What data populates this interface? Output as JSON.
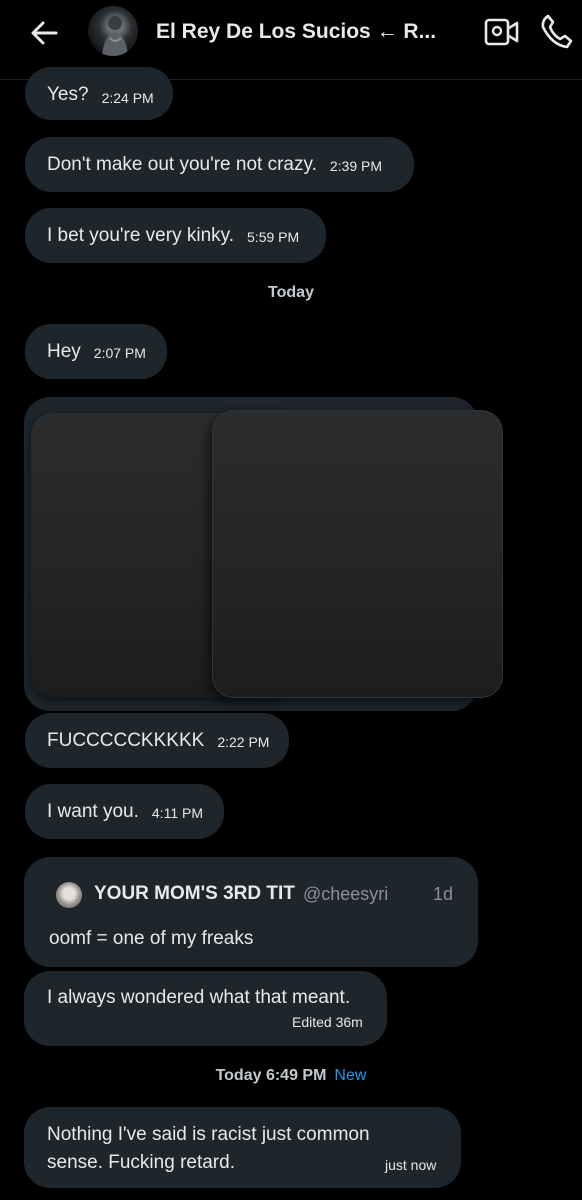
{
  "header": {
    "title": "El Rey De Los Sucios ← R...",
    "back_icon": "arrow-left-icon",
    "video_icon": "video-call-icon",
    "phone_icon": "phone-icon"
  },
  "messages": [
    {
      "text": "Yes?",
      "time": "2:24 PM"
    },
    {
      "text": "Don't make out you're not crazy.",
      "time": "2:39 PM"
    },
    {
      "text": "I bet you're very kinky.",
      "time": "5:59 PM"
    },
    {
      "text": "Hey",
      "time": "2:07 PM"
    },
    {
      "text": "FUCCCCCKKKKK",
      "time": "2:22 PM"
    },
    {
      "text": "I want you.",
      "time": "4:11 PM"
    }
  ],
  "dividers": {
    "today": "Today",
    "today_time": "Today 6:49 PM",
    "new_label": "New"
  },
  "quoted_post": {
    "name": "YOUR MOM'S 3RD TIT",
    "handle": "@cheesyri",
    "age": "1d",
    "text": "oomf = one of my freaks"
  },
  "quote_reply": {
    "text": "I always wondered what that meant.",
    "meta": "Edited 36m"
  },
  "last_message": {
    "line1": "Nothing I've said is racist just common",
    "line2": "sense. Fucking retard.",
    "meta": "just now"
  },
  "colors": {
    "background": "#000000",
    "bubble": "#1e252b",
    "text": "#e7e9ea",
    "muted": "#8b9196",
    "accent": "#1d9bf0"
  }
}
